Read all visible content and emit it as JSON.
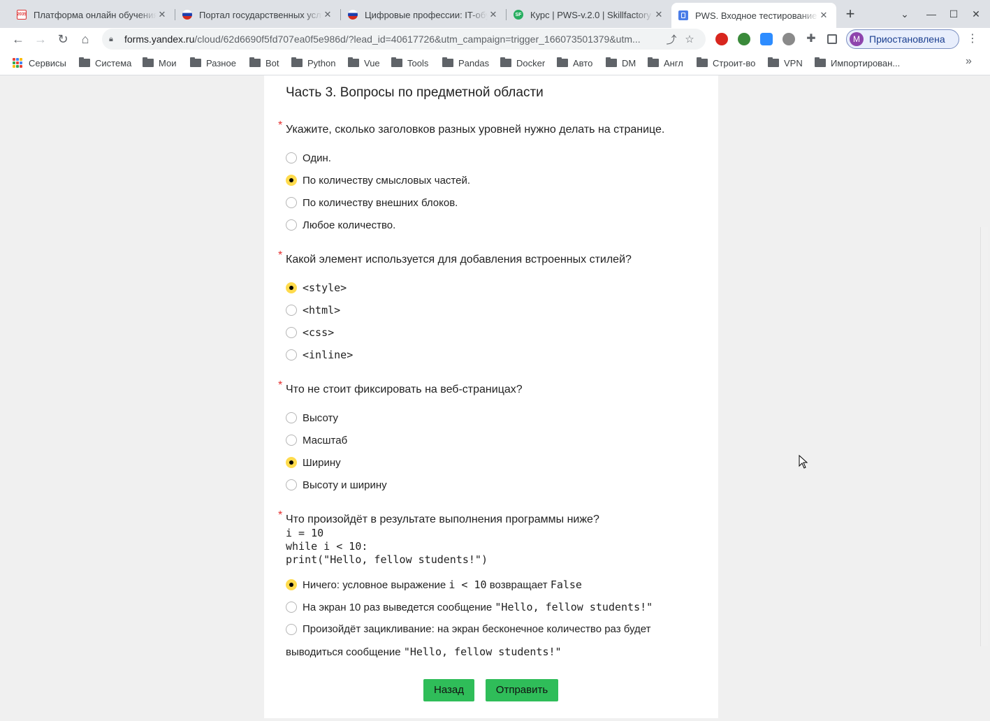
{
  "browser": {
    "tabs": [
      {
        "title": "Платформа онлайн обучения",
        "favicon": "2035"
      },
      {
        "title": "Портал государственных услуг",
        "favicon": "flag"
      },
      {
        "title": "Цифровые профессии: IT-обучение",
        "favicon": "flag"
      },
      {
        "title": "Курс | PWS-v.2.0 | Skillfactory",
        "favicon": "SF"
      },
      {
        "title": "PWS. Входное тестирование",
        "favicon": "forms"
      }
    ],
    "new_tab": "+",
    "url_host": "forms.yandex.ru",
    "url_rest": "/cloud/62d6690f5fd707ea0f5e986d/?lead_id=40617726&utm_campaign=trigger_166073501379&utm...",
    "profile_initial": "M",
    "profile_label": "Приостановлена"
  },
  "bookmarks": [
    {
      "label": "Сервисы",
      "type": "apps"
    },
    {
      "label": "Система",
      "type": "folder"
    },
    {
      "label": "Мои",
      "type": "folder"
    },
    {
      "label": "Разное",
      "type": "folder"
    },
    {
      "label": "Bot",
      "type": "folder"
    },
    {
      "label": "Python",
      "type": "folder"
    },
    {
      "label": "Vue",
      "type": "folder"
    },
    {
      "label": "Tools",
      "type": "folder"
    },
    {
      "label": "Pandas",
      "type": "folder"
    },
    {
      "label": "Docker",
      "type": "folder"
    },
    {
      "label": "Авто",
      "type": "folder"
    },
    {
      "label": "DM",
      "type": "folder"
    },
    {
      "label": "Англ",
      "type": "folder"
    },
    {
      "label": "Строит-во",
      "type": "folder"
    },
    {
      "label": "VPN",
      "type": "folder"
    },
    {
      "label": "Импортирован...",
      "type": "folder"
    }
  ],
  "form": {
    "section_title": "Часть 3. Вопросы по предметной области",
    "required_mark": "*",
    "questions": [
      {
        "text": "Укажите, сколько заголовков разных уровней нужно делать на странице.",
        "options": [
          {
            "label": "Один.",
            "checked": false
          },
          {
            "label": "По количеству смысловых частей.",
            "checked": true
          },
          {
            "label": "По количеству внешних блоков.",
            "checked": false
          },
          {
            "label": "Любое количество.",
            "checked": false
          }
        ]
      },
      {
        "text": "Какой элемент используется для добавления встроенных стилей?",
        "options": [
          {
            "label": "<style>",
            "checked": true
          },
          {
            "label": "<html>",
            "checked": false
          },
          {
            "label": "<css>",
            "checked": false
          },
          {
            "label": "<inline>",
            "checked": false
          }
        ]
      },
      {
        "text": "Что не стоит фиксировать на веб-страницах?",
        "options": [
          {
            "label": "Высоту",
            "checked": false
          },
          {
            "label": "Масштаб",
            "checked": false
          },
          {
            "label": "Ширину",
            "checked": true
          },
          {
            "label": "Высоту и ширину",
            "checked": false
          }
        ]
      },
      {
        "text": "Что произойдёт в результате выполнения программы ниже?",
        "code": [
          "i = 10",
          "while i < 10:",
          "print(\"Hello, fellow students!\")"
        ],
        "options": [
          {
            "label_a": "Ничего: условное выражение ",
            "code_a": "i < 10",
            "label_b": " возвращает ",
            "code_b": "False",
            "checked": true
          },
          {
            "label_a": "На экран 10 раз выведется сообщение ",
            "code_a": "\"Hello, fellow students!\"",
            "checked": false
          },
          {
            "label_a": "Произойдёт зацикливание: на экран бесконечное количество раз будет выводиться сообщение ",
            "code_a": "\"Hello, fellow students!\"",
            "checked": false
          }
        ]
      }
    ],
    "back_label": "Назад",
    "submit_label": "Отправить"
  },
  "colors": {
    "accent_button": "#2fbd59",
    "radio_checked": "#ffdb4d",
    "required": "#e62e2e"
  }
}
